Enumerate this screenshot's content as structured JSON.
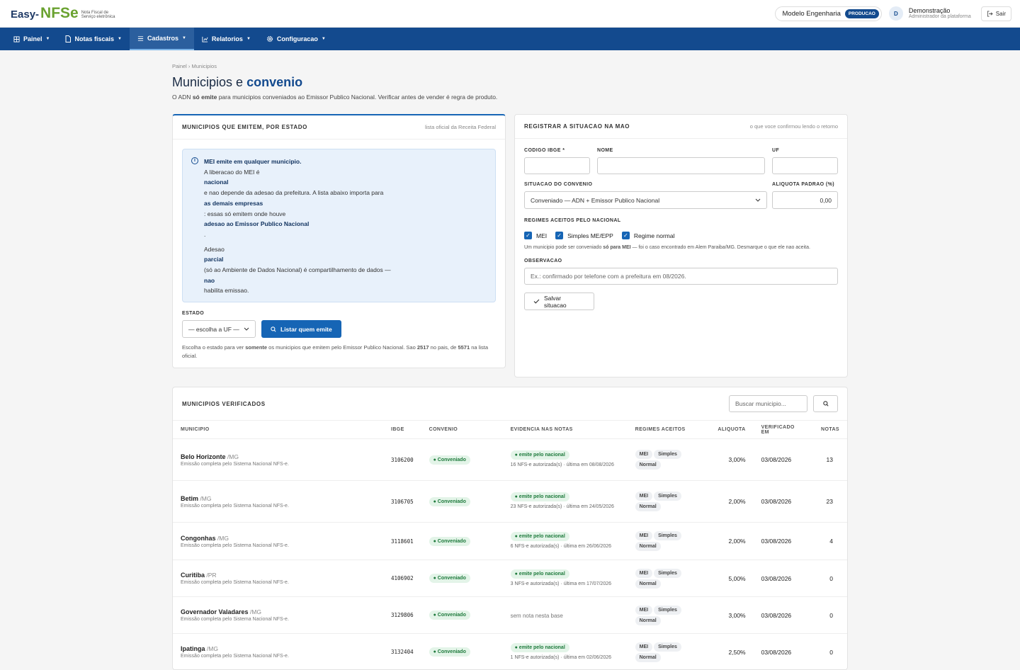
{
  "header": {
    "logo_main": "Easy-",
    "logo_nfse": "NFSe",
    "logo_sub1": "Nota Fiscal de",
    "logo_sub2": "Serviço eletrônica",
    "company": "Modelo Engenharia",
    "env_badge": "PRODUCAO",
    "avatar_letter": "D",
    "user_name": "Demonstração",
    "user_role": "Administrador da plataforma",
    "logout": "Sair"
  },
  "nav": [
    {
      "label": "Painel",
      "icon": "grid-icon"
    },
    {
      "label": "Notas fiscais",
      "icon": "document-icon"
    },
    {
      "label": "Cadastros",
      "icon": "list-icon",
      "active": true
    },
    {
      "label": "Relatorios",
      "icon": "chart-icon"
    },
    {
      "label": "Configuracao",
      "icon": "gear-icon"
    }
  ],
  "page": {
    "breadcrumb": "Painel › Municipios",
    "title_prefix": "Municipios e",
    "title_bold": "convenio",
    "lead_pre": "O ADN",
    "lead_bold": "só emite",
    "lead_post": "para municipios conveniados ao Emissor Publico Nacional. Verificar antes de vender é regra de produto."
  },
  "emitters": {
    "title": "MUNICIPIOS QUE EMITEM, POR ESTADO",
    "note": "lista oficial da Receita Federal",
    "info_lines": [
      {
        "t": "MEI emite em qualquer municipio.",
        "b": true
      },
      {
        "t": "A liberacao do MEI é"
      },
      {
        "t": "nacional",
        "b": true
      },
      {
        "t": "e nao depende da adesao da prefeitura. A lista abaixo importa para"
      },
      {
        "t": "as demais empresas",
        "b": true
      },
      {
        "t": ": essas só emitem onde houve"
      },
      {
        "t": "adesao ao Emissor Publico Nacional",
        "b": true
      },
      {
        "t": "."
      },
      {
        "t": ""
      },
      {
        "t": "Adesao"
      },
      {
        "t": "parcial",
        "b": true
      },
      {
        "t": "(só ao Ambiente de Dados Nacional) é compartilhamento de dados —"
      },
      {
        "t": "nao",
        "b": true
      },
      {
        "t": "habilita emissao."
      }
    ],
    "state_label": "ESTADO",
    "state_value": "— escolha a UF —",
    "list_button": "Listar quem emite",
    "help_1": "Escolha o estado para ver",
    "help_bold1": "somente",
    "help_2": "os municipios que emitem pelo Emissor Publico Nacional. Sao",
    "help_bold2": "2517",
    "help_3": "no pais, de",
    "help_bold3": "5571",
    "help_4": "na lista oficial."
  },
  "register": {
    "title": "REGISTRAR A SITUACAO NA MAO",
    "note": "o que voce confirmou lendo o retorno",
    "ibge_label": "CODIGO IBGE *",
    "nome_label": "NOME",
    "uf_label": "UF",
    "situacao_label": "SITUACAO DO CONVENIO",
    "situacao_value": "Conveniado — ADN + Emissor Publico Nacional",
    "aliquota_label": "ALIQUOTA PADRAO (%)",
    "aliquota_value": "0,00",
    "regimes_label": "REGIMES ACEITOS PELO NACIONAL",
    "regimes": [
      "MEI",
      "Simples ME/EPP",
      "Regime normal"
    ],
    "regimes_help_pre": "Um municipio pode ser conveniado",
    "regimes_help_bold": "só para MEI",
    "regimes_help_post": "— foi o caso encontrado em Alem Paraiba/MG. Desmarque o que ele nao aceita.",
    "obs_label": "OBSERVACAO",
    "obs_placeholder": "Ex.: confirmado por telefone com a prefeitura em 08/2026.",
    "save_button": "Salvar situacao"
  },
  "verified": {
    "title": "MUNICIPIOS VERIFICADOS",
    "search_placeholder": "Buscar municipio...",
    "columns": [
      "MUNICIPIO",
      "IBGE",
      "CONVENIO",
      "EVIDENCIA NAS NOTAS",
      "REGIMES ACEITOS",
      "ALIQUOTA",
      "VERIFICADO EM",
      "NOTAS"
    ],
    "rows": [
      {
        "nome": "Belo Horizonte",
        "uf": "/MG",
        "desc": "Emissão completa pelo Sistema Nacional NFS-e.",
        "ibge": "3106200",
        "convenio": "Conveniado",
        "ev_tag": "emite pelo nacional",
        "ev_text": "16 NFS-e autorizada(s) · última em 08/08/2026",
        "regimes": [
          "MEI",
          "Simples",
          "Normal"
        ],
        "aliquota": "3,00%",
        "verificado": "03/08/2026",
        "notas": "13"
      },
      {
        "nome": "Betim",
        "uf": "/MG",
        "desc": "Emissão completa pelo Sistema Nacional NFS-e.",
        "ibge": "3106705",
        "convenio": "Conveniado",
        "ev_tag": "emite pelo nacional",
        "ev_text": "23 NFS-e autorizada(s) · última em 24/05/2026",
        "regimes": [
          "MEI",
          "Simples",
          "Normal"
        ],
        "aliquota": "2,00%",
        "verificado": "03/08/2026",
        "notas": "23"
      },
      {
        "nome": "Congonhas",
        "uf": "/MG",
        "desc": "Emissão completa pelo Sistema Nacional NFS-e.",
        "ibge": "3118601",
        "convenio": "Conveniado",
        "ev_tag": "emite pelo nacional",
        "ev_text": "6 NFS-e autorizada(s) · última em 26/06/2026",
        "regimes": [
          "MEI",
          "Simples",
          "Normal"
        ],
        "aliquota": "2,00%",
        "verificado": "03/08/2026",
        "notas": "4"
      },
      {
        "nome": "Curitiba",
        "uf": "/PR",
        "desc": "Emissão completa pelo Sistema Nacional NFS-e.",
        "ibge": "4106902",
        "convenio": "Conveniado",
        "ev_tag": "emite pelo nacional",
        "ev_text": "3 NFS-e autorizada(s) · última em 17/07/2026",
        "regimes": [
          "MEI",
          "Simples",
          "Normal"
        ],
        "aliquota": "5,00%",
        "verificado": "03/08/2026",
        "notas": "0"
      },
      {
        "nome": "Governador Valadares",
        "uf": "/MG",
        "desc": "Emissão completa pelo Sistema Nacional NFS-e.",
        "ibge": "3129806",
        "convenio": "Conveniado",
        "ev_tag": "",
        "ev_text": "sem nota nesta base",
        "regimes": [
          "MEI",
          "Simples",
          "Normal"
        ],
        "aliquota": "3,00%",
        "verificado": "03/08/2026",
        "notas": "0"
      },
      {
        "nome": "Ipatinga",
        "uf": "/MG",
        "desc": "Emissão completa pelo Sistema Nacional NFS-e.",
        "ibge": "3132404",
        "convenio": "Conveniado",
        "ev_tag": "emite pelo nacional",
        "ev_text": "1 NFS-e autorizada(s) · última em 02/06/2026",
        "regimes": [
          "MEI",
          "Simples",
          "Normal"
        ],
        "aliquota": "2,50%",
        "verificado": "03/08/2026",
        "notas": "0"
      }
    ]
  }
}
